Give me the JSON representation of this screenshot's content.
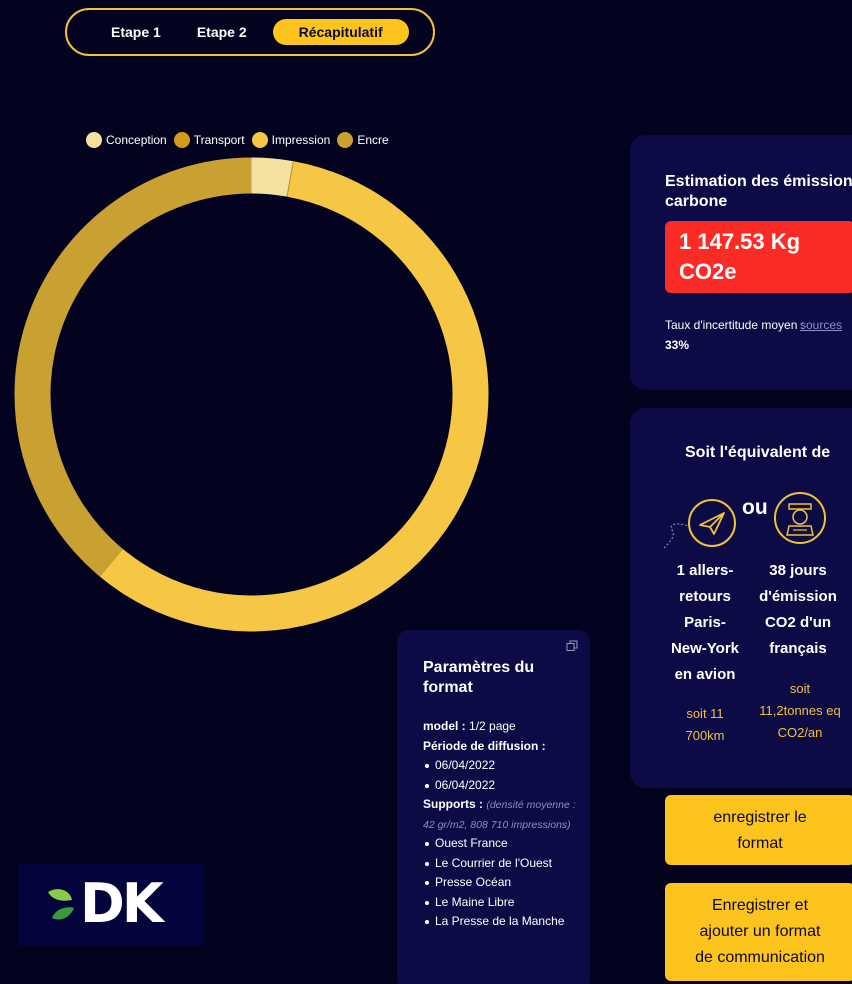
{
  "stepper": {
    "step1": "Etape 1",
    "step2": "Etape 2",
    "step3": "Récapitulatif",
    "active": "step3"
  },
  "chart_data": {
    "type": "pie",
    "donut": true,
    "categories": [
      "Conception",
      "Transport",
      "Impression",
      "Encre"
    ],
    "values": [
      2.8,
      0.05,
      58.2,
      38.95
    ],
    "colors": [
      "#f4e19f",
      "#d49a1a",
      "#f6c744",
      "#c9a133"
    ],
    "legend_position": "top",
    "title": ""
  },
  "emission": {
    "title": "Estimation des émissions carbone",
    "value_line1": "1 147.53 Kg",
    "value_line2": "CO2e",
    "uncertainty_label": "Taux d'incertitude moyen :",
    "uncertainty_value": "33%",
    "sources_link": "sources"
  },
  "equivalent": {
    "title": "Soit l'équivalent de",
    "or": "ou",
    "flight": {
      "icon": "paper-plane-icon",
      "line1": "1 allers-",
      "line2": "retours",
      "line3": "Paris-",
      "line4": "New-York",
      "line5": "en avion",
      "sub1": "soit 11",
      "sub2": "700km"
    },
    "person": {
      "icon": "person-icon",
      "line1": "38 jours",
      "line2": "d'émission",
      "line3": "CO2 d'un",
      "line4": "français",
      "sub1": "soit",
      "sub2": "11,2tonnes eq",
      "sub3": "CO2/an"
    }
  },
  "buttons": {
    "save_line1": "enregistrer le",
    "save_line2": "format",
    "save_add_line1": "Enregistrer et",
    "save_add_line2": "ajouter un format",
    "save_add_line3": "de communication"
  },
  "params": {
    "title_line1": "Paramètres du",
    "title_line2": "format",
    "model_label": "model :",
    "model_value": "1/2 page",
    "period_label": "Période de diffusion :",
    "periods": [
      "06/04/2022",
      "06/04/2022"
    ],
    "supports_label": "Supports :",
    "supports_note": "(densité moyenne : 42 gr/m2, 808 710 impressions)",
    "supports": [
      "Ouest France",
      "Le Courrier de l'Ouest",
      "Presse Océan",
      "Le Maine Libre",
      "La Presse de la Manche"
    ]
  },
  "logo": {
    "text": "DK",
    "colors": {
      "leaf_light": "#8ccb47",
      "leaf_dark": "#3a9a3a",
      "text": "#ffffff",
      "bg": "#04043d"
    }
  },
  "colors": {
    "background": "#03031f",
    "card": "#0c0b45",
    "accent": "#fcc41d",
    "alert": "#fc2b25"
  }
}
